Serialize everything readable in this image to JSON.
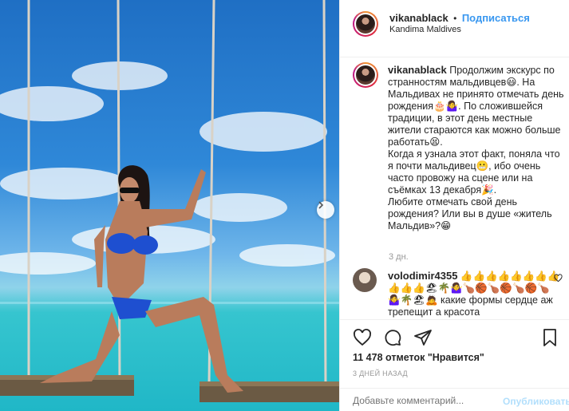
{
  "post": {
    "nav_arrow": "chevron-right-icon"
  },
  "header": {
    "username": "vikanablack",
    "dot": "•",
    "follow_label": "Подписаться",
    "location": "Kandima Maldives"
  },
  "caption": {
    "username": "vikanablack",
    "text": "Продолжим экскурс по странностям мальдивцев😃. На Мальдивах не принято отмечать день рождения🎂🤷‍♀️. По сложившейся традиции, в этот день местные жители стараются как можно больше работать😫.\nКогда я узнала этот факт, поняла что я почти мальдивец😬, ибо очень часто провожу на сцене или на съёмках 13 декабря🎉.\nЛюбите отмечать свой день рождения? Или вы в душе «житель Мальдив»?😁",
    "time": "3 дн."
  },
  "comment": {
    "username": "volodimir4355",
    "text": "👍👍👍👍👍👍👍👍👍👍👍🏖🌴🤷‍♀️🍗🏀🍗🏀🍗🏀🍗🤷‍♀️🌴🏖🙇 какие формы сердце аж трепещит а красота"
  },
  "actions": {
    "likes": "11 478 отметок \"Нравится\"",
    "date": "3 ДНЕЙ НАЗАД",
    "comment_placeholder": "Добавьте комментарий...",
    "publish_label": "Опубликовать"
  },
  "colors": {
    "link": "#3897f0",
    "muted": "#999999",
    "publish_disabled": "#b2dffc"
  }
}
